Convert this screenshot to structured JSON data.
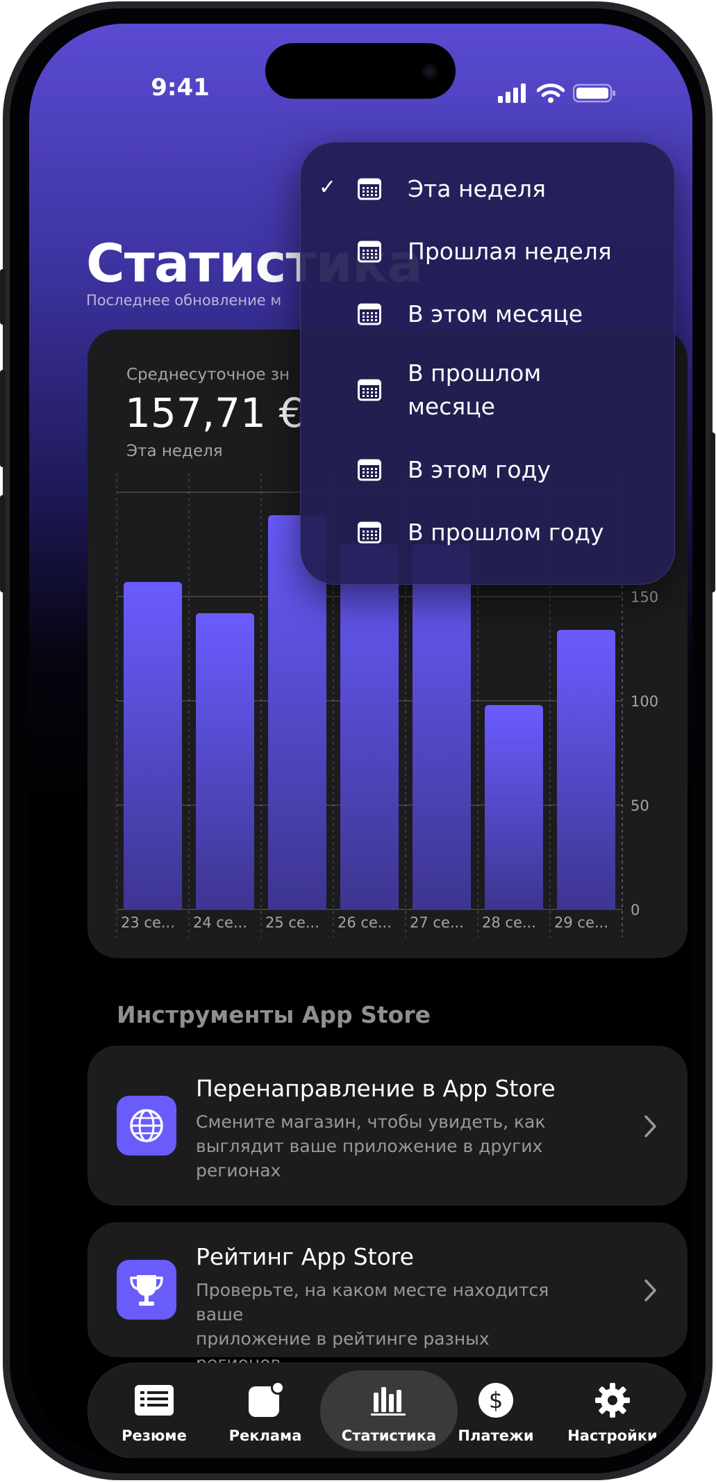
{
  "status_bar": {
    "time": "9:41"
  },
  "header": {
    "title": "Статистика",
    "subtitle": "Последнее обновление м"
  },
  "stats_card": {
    "label": "Среднесуточное зн",
    "value": "157,71 €",
    "period": "Эта неделя"
  },
  "chart_data": {
    "type": "bar",
    "categories": [
      "23 се...",
      "24 се...",
      "25 се...",
      "26 се...",
      "27 се...",
      "28 се...",
      "29 се..."
    ],
    "values": [
      157,
      142,
      189,
      175,
      175,
      98,
      134
    ],
    "y_ticks": [
      0,
      50,
      100,
      150
    ],
    "ylim": [
      0,
      200
    ],
    "grid": true,
    "colors": {
      "bar_top": "#6b5cff",
      "bar_bottom": "#3d3590"
    }
  },
  "period_menu": {
    "items": [
      {
        "label": "Эта неделя",
        "selected": true
      },
      {
        "label": "Прошлая неделя",
        "selected": false
      },
      {
        "label": "В этом месяце",
        "selected": false
      },
      {
        "label": "В прошлом месяце",
        "line1": "В прошлом",
        "line2": "месяце",
        "selected": false
      },
      {
        "label": "В этом году",
        "selected": false
      },
      {
        "label": "В прошлом году",
        "selected": false
      }
    ],
    "check_symbol": "✓",
    "item_icon": "calendar-icon"
  },
  "tools_section": {
    "title": "Инструменты App Store",
    "items": [
      {
        "title": "Перенаправление в App Store",
        "desc_lines": [
          "Смените магазин, чтобы увидеть, как",
          "выглядит ваше приложение в других",
          "регионах"
        ],
        "icon": "globe-icon"
      },
      {
        "title": "Рейтинг App Store",
        "desc_lines": [
          "Проверьте, на каком месте находится ваше",
          "приложение в рейтинге разных регионов"
        ],
        "icon": "trophy-icon"
      }
    ]
  },
  "tab_bar": {
    "tabs": [
      {
        "label": "Резюме",
        "icon": "summary-icon",
        "active": false
      },
      {
        "label": "Реклама",
        "icon": "ads-icon",
        "active": false
      },
      {
        "label": "Статистика",
        "icon": "stats-icon",
        "active": true
      },
      {
        "label": "Платежи",
        "icon": "dollar-icon",
        "active": false
      },
      {
        "label": "Настройки",
        "icon": "gear-icon",
        "active": false
      }
    ]
  },
  "colors": {
    "accent": "#6a5cfb",
    "card_bg": "#1c1c1e"
  }
}
